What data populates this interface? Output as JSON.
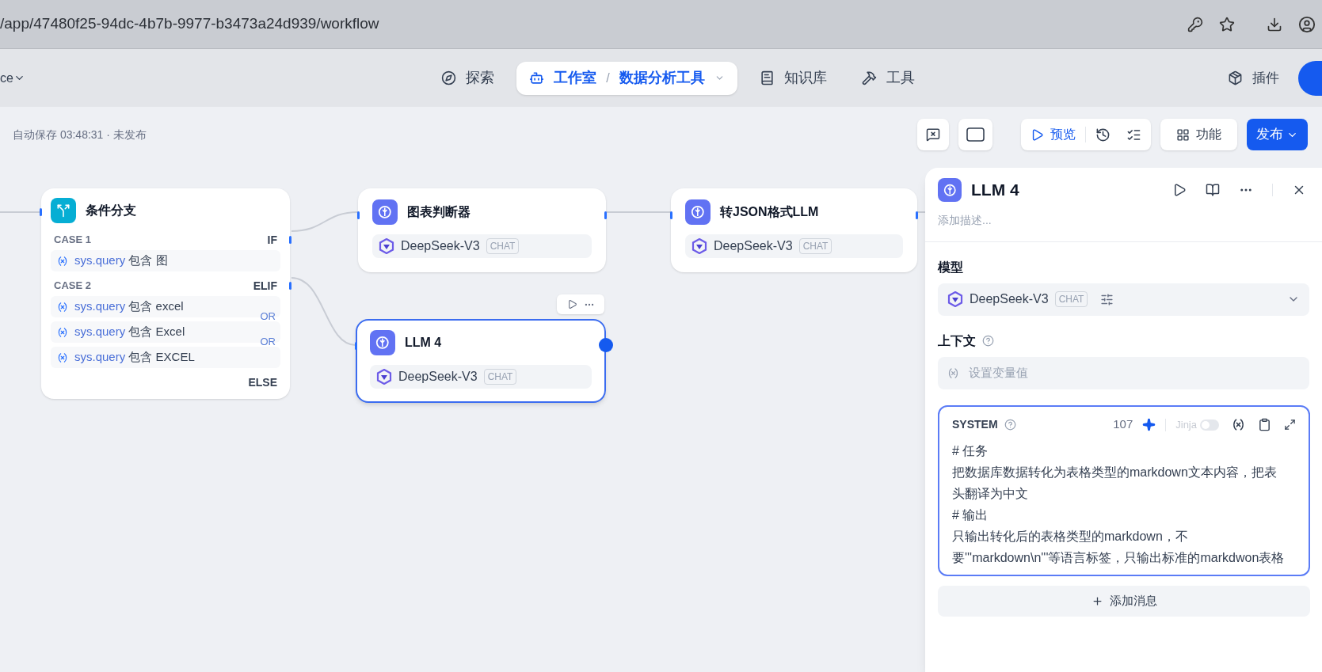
{
  "browser": {
    "url": "/app/47480f25-94dc-4b7b-9977-b3473a24d939/workflow"
  },
  "header": {
    "workspace": "ce",
    "nav": [
      {
        "label": "探索",
        "selected": false
      },
      {
        "label": "工作室",
        "selected": true,
        "separator": "/",
        "sub": "数据分析工具"
      },
      {
        "label": "知识库",
        "selected": false
      },
      {
        "label": "工具",
        "selected": false
      }
    ],
    "plugins": "插件"
  },
  "toolbar": {
    "autosave": "自动保存 03:48:31 · 未发布",
    "preview": "预览",
    "features": "功能",
    "publish": "发布"
  },
  "nodes": [
    {
      "kind": "if_else",
      "title": "条件分支",
      "cases": [
        {
          "label": "CASE 1",
          "branch": "IF",
          "conditions": [
            {
              "var": "sys.query",
              "op": "包含",
              "value": "图"
            }
          ]
        },
        {
          "label": "CASE 2",
          "branch": "ELIF",
          "conditions": [
            {
              "var": "sys.query",
              "op": "包含",
              "value": "excel"
            },
            {
              "joiner": "OR",
              "var": "sys.query",
              "op": "包含",
              "value": "Excel"
            },
            {
              "joiner": "OR",
              "var": "sys.query",
              "op": "包含",
              "value": "EXCEL"
            }
          ]
        }
      ],
      "else": "ELSE"
    },
    {
      "kind": "llm",
      "title": "图表判断器",
      "model": "DeepSeek-V3",
      "mode": "CHAT",
      "selected": false
    },
    {
      "kind": "llm",
      "title": "转JSON格式LLM",
      "model": "DeepSeek-V3",
      "mode": "CHAT",
      "selected": false
    },
    {
      "kind": "llm",
      "title": "LLM 4",
      "model": "DeepSeek-V3",
      "mode": "CHAT",
      "selected": true
    }
  ],
  "panel": {
    "title": "LLM 4",
    "description_placeholder": "添加描述...",
    "model_label": "模型",
    "model": "DeepSeek-V3",
    "mode": "CHAT",
    "context_label": "上下文",
    "context_placeholder": "设置变量值",
    "prompt": {
      "role": "SYSTEM",
      "count": "107",
      "jinja_label": "Jinja",
      "jinja_on": false,
      "lines": [
        "# 任务",
        "把数据库数据转化为表格类型的markdown文本内容，把表头翻译为中文",
        "# 输出",
        "只输出转化后的表格类型的markdown，不要'''markdown\\n'''等语言标签，只输出标准的markdwon表格"
      ]
    },
    "add_message": "添加消息"
  }
}
